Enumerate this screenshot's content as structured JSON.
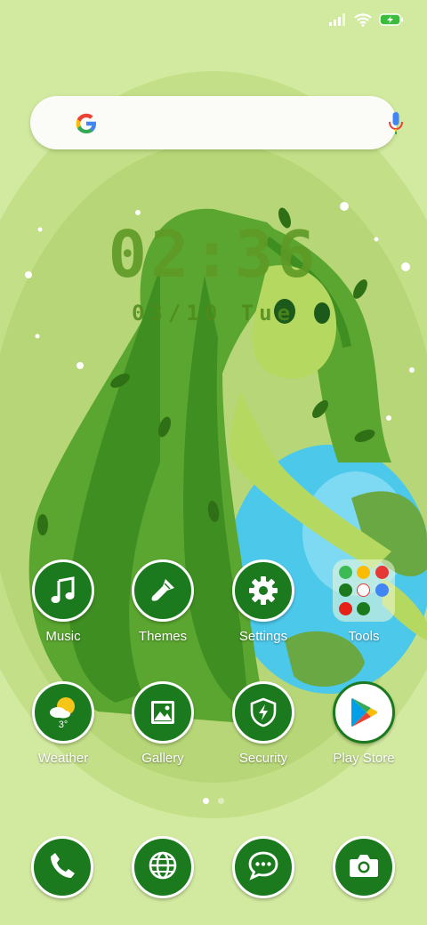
{
  "status_bar": {
    "signal": "signal-bars-icon",
    "wifi": "wifi-icon",
    "battery": "battery-charging-icon"
  },
  "search": {
    "logo": "google-g-icon",
    "voice": "microphone-icon"
  },
  "clock": {
    "time": "02:36",
    "date": "03/10 Tue"
  },
  "apps": [
    {
      "label": "Music",
      "icon": "music-note-icon"
    },
    {
      "label": "Themes",
      "icon": "paintbrush-icon"
    },
    {
      "label": "Settings",
      "icon": "gear-icon"
    },
    {
      "label": "Tools",
      "icon": "folder-icon"
    },
    {
      "label": "Weather",
      "icon": "sun-cloud-icon",
      "temp": "3°"
    },
    {
      "label": "Gallery",
      "icon": "image-icon"
    },
    {
      "label": "Security",
      "icon": "shield-bolt-icon"
    },
    {
      "label": "Play Store",
      "icon": "play-store-icon"
    }
  ],
  "dock": [
    {
      "icon": "phone-icon"
    },
    {
      "icon": "globe-icon"
    },
    {
      "icon": "chat-icon"
    },
    {
      "icon": "camera-icon"
    }
  ],
  "page_indicator": {
    "pages": 2,
    "current": 1
  },
  "colors": {
    "icon_bg": "#1c7a1e",
    "wallpaper_bg": "#d2e9a0",
    "label": "#ffffff"
  }
}
